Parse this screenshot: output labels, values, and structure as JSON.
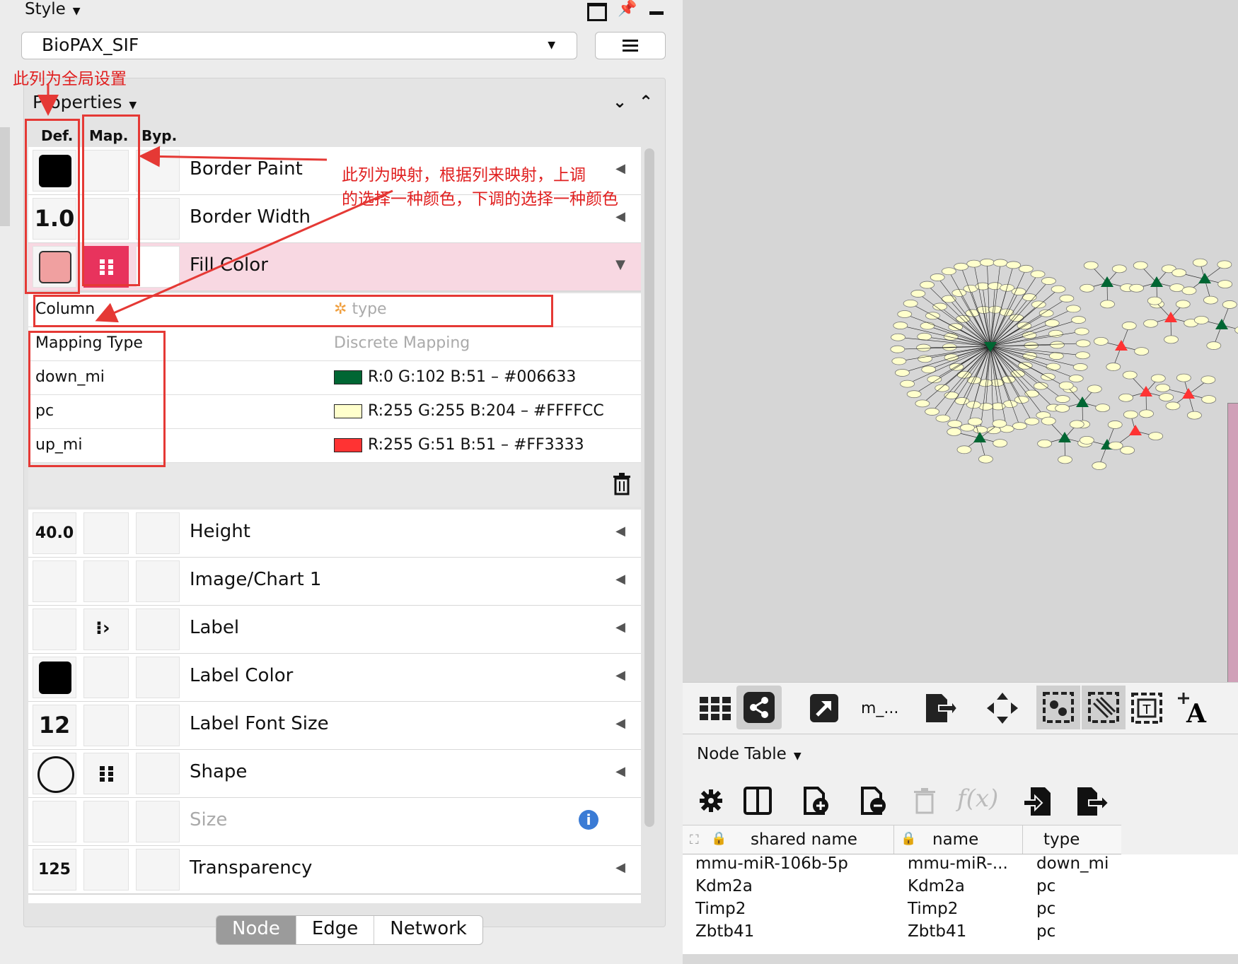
{
  "style_panel": {
    "title": "Style",
    "style_name": "BioPAX_SIF",
    "properties_label": "Properties",
    "columns": {
      "def": "Def.",
      "map": "Map.",
      "byp": "Byp."
    },
    "rows": {
      "border_paint": {
        "label": "Border Paint"
      },
      "border_width": {
        "label": "Border Width",
        "def": "1.0"
      },
      "fill_color": {
        "label": "Fill Color"
      },
      "height": {
        "label": "Height",
        "def": "40.0"
      },
      "image_chart": {
        "label": "Image/Chart 1"
      },
      "label": {
        "label": "Label"
      },
      "label_color": {
        "label": "Label Color"
      },
      "label_font_size": {
        "label": "Label Font Size",
        "def": "12"
      },
      "shape": {
        "label": "Shape"
      },
      "size": {
        "label": "Size"
      },
      "transparency": {
        "label": "Transparency",
        "def": "125"
      }
    },
    "mapping": {
      "column_label": "Column",
      "column_value": "type",
      "type_label": "Mapping Type",
      "type_value": "Discrete Mapping",
      "entries": [
        {
          "key": "down_mi",
          "value": "R:0 G:102 B:51 – #006633",
          "color": "#006633"
        },
        {
          "key": "pc",
          "value": "R:255 G:255 B:204 – #FFFFCC",
          "color": "#FFFFCC"
        },
        {
          "key": "up_mi",
          "value": "R:255 G:51 B:51 – #FF3333",
          "color": "#FF3333"
        }
      ]
    },
    "tabs": [
      "Node",
      "Edge",
      "Network"
    ],
    "fill_default_color": "#f0a0a0",
    "map_accent": "#e8335d"
  },
  "annotations": {
    "global_note": "此列为全局设置",
    "mapping_note_1": "此列为映射，根据列来映射，上调",
    "mapping_note_2": "的选择一种颜色，下调的选择一种颜色"
  },
  "toolbar": {
    "network_name": "m_..."
  },
  "node_table": {
    "title": "Node Table",
    "headers": [
      "shared name",
      "name",
      "type"
    ],
    "rows": [
      [
        "mmu-miR-106b-5p",
        "mmu-miR-...",
        "down_mi"
      ],
      [
        "Kdm2a",
        "Kdm2a",
        "pc"
      ],
      [
        "Timp2",
        "Timp2",
        "pc"
      ],
      [
        "Zbtb41",
        "Zbtb41",
        "pc"
      ]
    ]
  }
}
